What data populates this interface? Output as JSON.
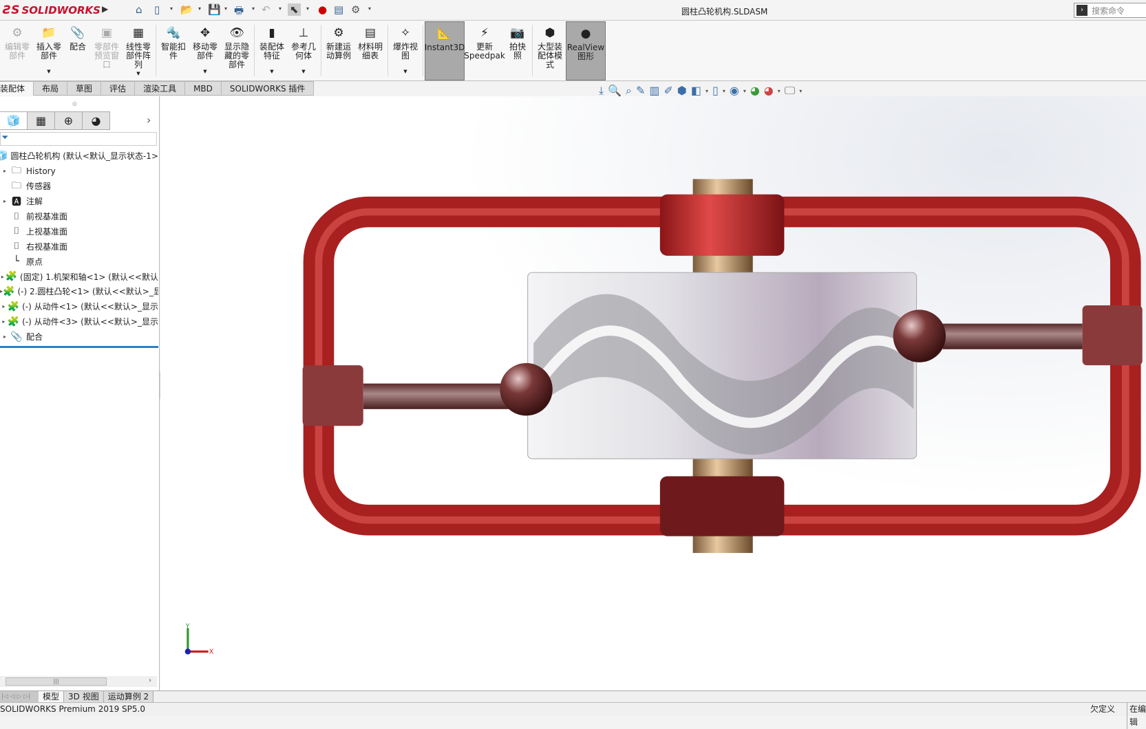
{
  "app": {
    "logo": "SOLIDWORKS",
    "document_title": "圆柱凸轮机构.SLDASM",
    "search_placeholder": "搜索命令"
  },
  "ribbon": [
    {
      "label": "编辑零部件",
      "icon": "edit-component-icon",
      "disabled": true
    },
    {
      "label": "插入零部件",
      "icon": "insert-component-icon",
      "dropdown": true
    },
    {
      "label": "配合",
      "icon": "mate-icon"
    },
    {
      "label": "零部件预览窗口",
      "icon": "component-preview-icon",
      "disabled": true
    },
    {
      "label": "线性零部件阵列",
      "icon": "linear-pattern-icon",
      "dropdown": true
    },
    {
      "label": "智能扣件",
      "icon": "smart-fasteners-icon"
    },
    {
      "label": "移动零部件",
      "icon": "move-component-icon",
      "dropdown": true
    },
    {
      "label": "显示隐藏的零部件",
      "icon": "show-hidden-icon"
    },
    {
      "label": "装配体特征",
      "icon": "assembly-feature-icon",
      "dropdown": true
    },
    {
      "label": "参考几何体",
      "icon": "reference-geometry-icon",
      "dropdown": true
    },
    {
      "label": "新建运动算例",
      "icon": "motion-study-icon"
    },
    {
      "label": "材料明细表",
      "icon": "bom-icon"
    },
    {
      "label": "爆炸视图",
      "icon": "exploded-view-icon",
      "dropdown": true
    },
    {
      "label": "Instant3D",
      "icon": "instant3d-icon",
      "active": true
    },
    {
      "label": "更新Speedpak",
      "icon": "speedpak-icon"
    },
    {
      "label": "拍快照",
      "icon": "snapshot-icon"
    },
    {
      "label": "大型装配体模式",
      "icon": "large-assembly-icon"
    },
    {
      "label": "RealView图形",
      "icon": "realview-icon",
      "active": true
    }
  ],
  "command_tabs": [
    "装配体",
    "布局",
    "草图",
    "评估",
    "渲染工具",
    "MBD",
    "SOLIDWORKS 插件"
  ],
  "tree": [
    {
      "label": "圆柱凸轮机构  (默认<默认_显示状态-1>",
      "icon": "assembly-icon",
      "root": true
    },
    {
      "label": "History",
      "icon": "history-folder-icon",
      "expand": true
    },
    {
      "label": "传感器",
      "icon": "sensor-folder-icon"
    },
    {
      "label": "注解",
      "icon": "annotation-folder-icon",
      "expand": true
    },
    {
      "label": "前视基准面",
      "icon": "plane-icon"
    },
    {
      "label": "上视基准面",
      "icon": "plane-icon"
    },
    {
      "label": "右视基准面",
      "icon": "plane-icon"
    },
    {
      "label": "原点",
      "icon": "origin-icon"
    },
    {
      "label": "(固定) 1.机架和轴<1> (默认<<默认",
      "icon": "part-icon",
      "expand": true
    },
    {
      "label": "(-) 2.圆柱凸轮<1> (默认<<默认>_显",
      "icon": "part-icon",
      "expand": true
    },
    {
      "label": "(-) 从动件<1> (默认<<默认>_显示",
      "icon": "part-icon",
      "expand": true
    },
    {
      "label": "(-) 从动件<3> (默认<<默认>_显示",
      "icon": "part-icon",
      "expand": true
    },
    {
      "label": "配合",
      "icon": "mates-icon",
      "expand": true
    }
  ],
  "bottom_tabs": [
    "模型",
    "3D 视图",
    "运动算例 2"
  ],
  "status": {
    "version": "SOLIDWORKS Premium 2019 SP5.0",
    "definition": "欠定义",
    "editing": "在编辑"
  },
  "colors": {
    "frame_red": "#c8292b",
    "accent_blue": "#2e7fc1",
    "cam_silver": "#d9d9dc"
  }
}
